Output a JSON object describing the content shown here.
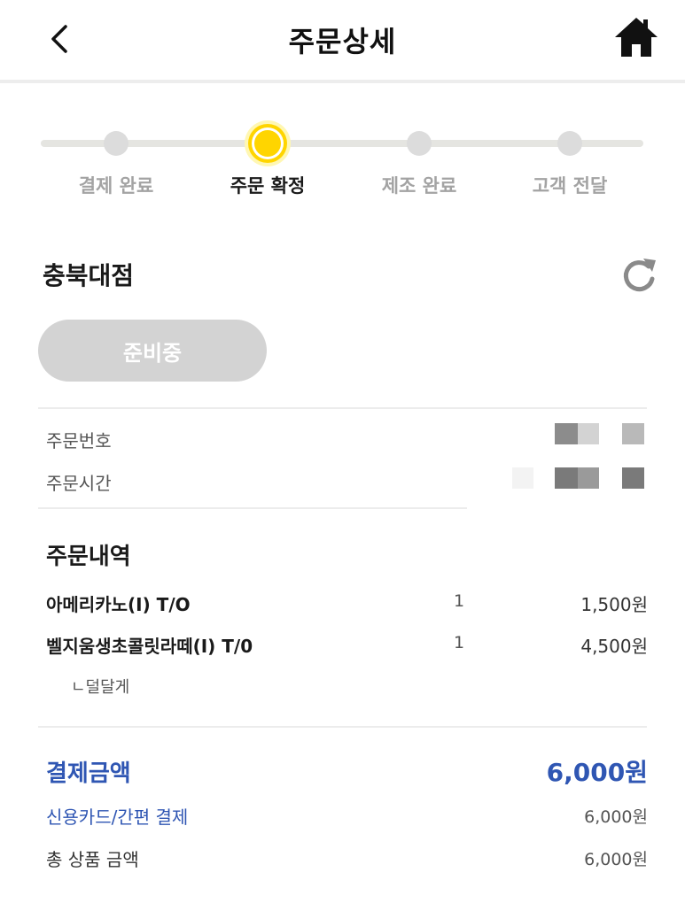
{
  "header": {
    "title": "주문상세",
    "back_icon": "chevron-left-icon",
    "home_icon": "home-icon"
  },
  "progress": {
    "steps": [
      {
        "label": "결제 완료",
        "active": false
      },
      {
        "label": "주문 확정",
        "active": true
      },
      {
        "label": "제조 완료",
        "active": false
      },
      {
        "label": "고객 전달",
        "active": false
      }
    ],
    "accent_color": "#ffd500"
  },
  "store": {
    "name": "충북대점",
    "refresh_icon": "refresh-icon",
    "status_label": "준비중"
  },
  "order_info": {
    "number_label": "주문번호",
    "time_label": "주문시간"
  },
  "items_section": {
    "title": "주문내역",
    "items": [
      {
        "name": "아메리카노(I) T/O",
        "qty": "1",
        "price": "1,500원"
      },
      {
        "name": "벨지움생초콜릿라떼(I) T/0",
        "qty": "1",
        "price": "4,500원"
      }
    ],
    "option": "ㄴ덜달게"
  },
  "payment": {
    "title": "결제금액",
    "total": "6,000원",
    "method_label": "신용카드/간편 결제",
    "method_amount": "6,000원",
    "product_total_label": "총 상품 금액",
    "product_total_amount": "6,000원",
    "accent_color": "#2f56b3"
  }
}
